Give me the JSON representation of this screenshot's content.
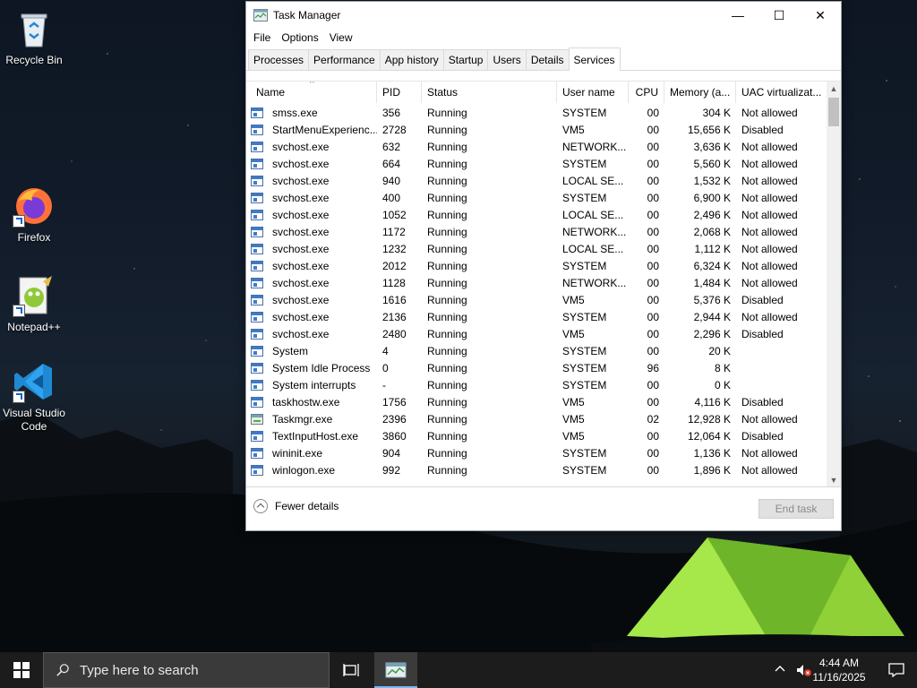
{
  "desktop": {
    "icons": [
      {
        "label": "Recycle Bin"
      },
      {
        "label": "Firefox"
      },
      {
        "label": "Notepad++"
      },
      {
        "label": "Visual Studio Code"
      }
    ]
  },
  "window": {
    "title": "Task Manager",
    "controls": {
      "minimize": "—",
      "maximize": "☐",
      "close": "✕"
    },
    "menu": [
      "File",
      "Options",
      "View"
    ],
    "tabs": [
      "Processes",
      "Performance",
      "App history",
      "Startup",
      "Users",
      "Details",
      "Services"
    ],
    "active_tab": "Services",
    "columns": [
      "Name",
      "PID",
      "Status",
      "User name",
      "CPU",
      "Memory (a...",
      "UAC virtualizat..."
    ],
    "rows": [
      {
        "name": "smss.exe",
        "pid": "356",
        "status": "Running",
        "user": "SYSTEM",
        "cpu": "00",
        "mem": "304 K",
        "uac": "Not allowed"
      },
      {
        "name": "StartMenuExperienc...",
        "pid": "2728",
        "status": "Running",
        "user": "VM5",
        "cpu": "00",
        "mem": "15,656 K",
        "uac": "Disabled"
      },
      {
        "name": "svchost.exe",
        "pid": "632",
        "status": "Running",
        "user": "NETWORK...",
        "cpu": "00",
        "mem": "3,636 K",
        "uac": "Not allowed"
      },
      {
        "name": "svchost.exe",
        "pid": "664",
        "status": "Running",
        "user": "SYSTEM",
        "cpu": "00",
        "mem": "5,560 K",
        "uac": "Not allowed"
      },
      {
        "name": "svchost.exe",
        "pid": "940",
        "status": "Running",
        "user": "LOCAL SE...",
        "cpu": "00",
        "mem": "1,532 K",
        "uac": "Not allowed"
      },
      {
        "name": "svchost.exe",
        "pid": "400",
        "status": "Running",
        "user": "SYSTEM",
        "cpu": "00",
        "mem": "6,900 K",
        "uac": "Not allowed"
      },
      {
        "name": "svchost.exe",
        "pid": "1052",
        "status": "Running",
        "user": "LOCAL SE...",
        "cpu": "00",
        "mem": "2,496 K",
        "uac": "Not allowed"
      },
      {
        "name": "svchost.exe",
        "pid": "1172",
        "status": "Running",
        "user": "NETWORK...",
        "cpu": "00",
        "mem": "2,068 K",
        "uac": "Not allowed"
      },
      {
        "name": "svchost.exe",
        "pid": "1232",
        "status": "Running",
        "user": "LOCAL SE...",
        "cpu": "00",
        "mem": "1,112 K",
        "uac": "Not allowed"
      },
      {
        "name": "svchost.exe",
        "pid": "2012",
        "status": "Running",
        "user": "SYSTEM",
        "cpu": "00",
        "mem": "6,324 K",
        "uac": "Not allowed"
      },
      {
        "name": "svchost.exe",
        "pid": "1128",
        "status": "Running",
        "user": "NETWORK...",
        "cpu": "00",
        "mem": "1,484 K",
        "uac": "Not allowed"
      },
      {
        "name": "svchost.exe",
        "pid": "1616",
        "status": "Running",
        "user": "VM5",
        "cpu": "00",
        "mem": "5,376 K",
        "uac": "Disabled"
      },
      {
        "name": "svchost.exe",
        "pid": "2136",
        "status": "Running",
        "user": "SYSTEM",
        "cpu": "00",
        "mem": "2,944 K",
        "uac": "Not allowed"
      },
      {
        "name": "svchost.exe",
        "pid": "2480",
        "status": "Running",
        "user": "VM5",
        "cpu": "00",
        "mem": "2,296 K",
        "uac": "Disabled"
      },
      {
        "name": "System",
        "pid": "4",
        "status": "Running",
        "user": "SYSTEM",
        "cpu": "00",
        "mem": "20 K",
        "uac": ""
      },
      {
        "name": "System Idle Process",
        "pid": "0",
        "status": "Running",
        "user": "SYSTEM",
        "cpu": "96",
        "mem": "8 K",
        "uac": ""
      },
      {
        "name": "System interrupts",
        "pid": "-",
        "status": "Running",
        "user": "SYSTEM",
        "cpu": "00",
        "mem": "0 K",
        "uac": ""
      },
      {
        "name": "taskhostw.exe",
        "pid": "1756",
        "status": "Running",
        "user": "VM5",
        "cpu": "00",
        "mem": "4,116 K",
        "uac": "Disabled"
      },
      {
        "name": "Taskmgr.exe",
        "pid": "2396",
        "status": "Running",
        "user": "VM5",
        "cpu": "02",
        "mem": "12,928 K",
        "uac": "Not allowed"
      },
      {
        "name": "TextInputHost.exe",
        "pid": "3860",
        "status": "Running",
        "user": "VM5",
        "cpu": "00",
        "mem": "12,064 K",
        "uac": "Disabled"
      },
      {
        "name": "wininit.exe",
        "pid": "904",
        "status": "Running",
        "user": "SYSTEM",
        "cpu": "00",
        "mem": "1,136 K",
        "uac": "Not allowed"
      },
      {
        "name": "winlogon.exe",
        "pid": "992",
        "status": "Running",
        "user": "SYSTEM",
        "cpu": "00",
        "mem": "1,896 K",
        "uac": "Not allowed"
      }
    ],
    "footer": {
      "fewer_details": "Fewer details",
      "end_task": "End task"
    }
  },
  "taskbar": {
    "search_placeholder": "Type here to search",
    "time": "4:44 AM",
    "date": "11/16/2025"
  },
  "colors": {
    "accent": "#77b7f5",
    "taskbar": "#1c1c1c",
    "tent": "#9be03a"
  }
}
